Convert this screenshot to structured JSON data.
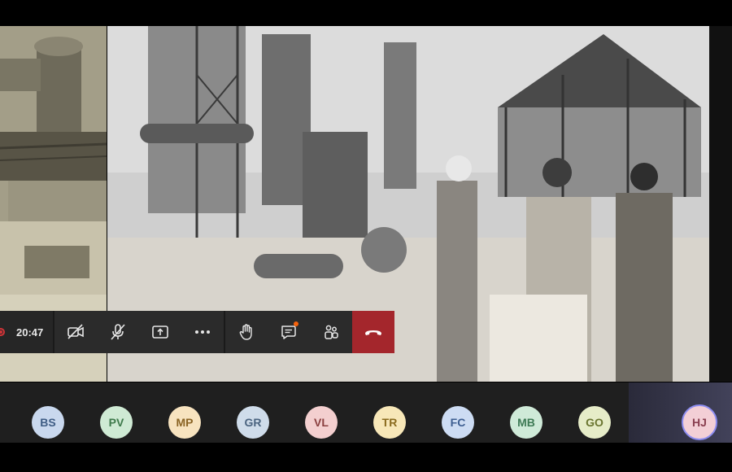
{
  "call": {
    "elapsed_time": "20:47",
    "recording": true
  },
  "colors": {
    "hangup": "#a4262c",
    "recording": "#d13438",
    "notification": "#f7630c",
    "self_ring": "#8c8cf0"
  },
  "controls": [
    {
      "name": "camera-off-button",
      "icon": "camera-off-icon"
    },
    {
      "name": "mic-off-button",
      "icon": "mic-off-icon"
    },
    {
      "name": "share-screen-button",
      "icon": "share-icon"
    },
    {
      "name": "more-options-button",
      "icon": "more-icon"
    },
    {
      "name": "raise-hand-button",
      "icon": "hand-icon"
    },
    {
      "name": "chat-button",
      "icon": "chat-icon"
    },
    {
      "name": "participants-button",
      "icon": "people-icon"
    },
    {
      "name": "hang-up-button",
      "icon": "phone-hangup-icon"
    }
  ],
  "participants": [
    {
      "initials": "BS",
      "bg": "#c9d8ee",
      "fg": "#3f5d85"
    },
    {
      "initials": "PV",
      "bg": "#cfead4",
      "fg": "#3e7a4b"
    },
    {
      "initials": "MP",
      "bg": "#f7e3bf",
      "fg": "#8a6424"
    },
    {
      "initials": "GR",
      "bg": "#cfdcea",
      "fg": "#4b6480"
    },
    {
      "initials": "VL",
      "bg": "#f3cfcf",
      "fg": "#8a3f3f"
    },
    {
      "initials": "TR",
      "bg": "#f7e7b8",
      "fg": "#8a6b1e"
    },
    {
      "initials": "FC",
      "bg": "#cddcf3",
      "fg": "#3e5f92"
    },
    {
      "initials": "MB",
      "bg": "#cfead8",
      "fg": "#3e7a55"
    },
    {
      "initials": "GO",
      "bg": "#e6ecc8",
      "fg": "#6a7530"
    }
  ],
  "self": {
    "initials": "HJ",
    "bg": "#f3cfd6",
    "fg": "#8a3f50"
  }
}
